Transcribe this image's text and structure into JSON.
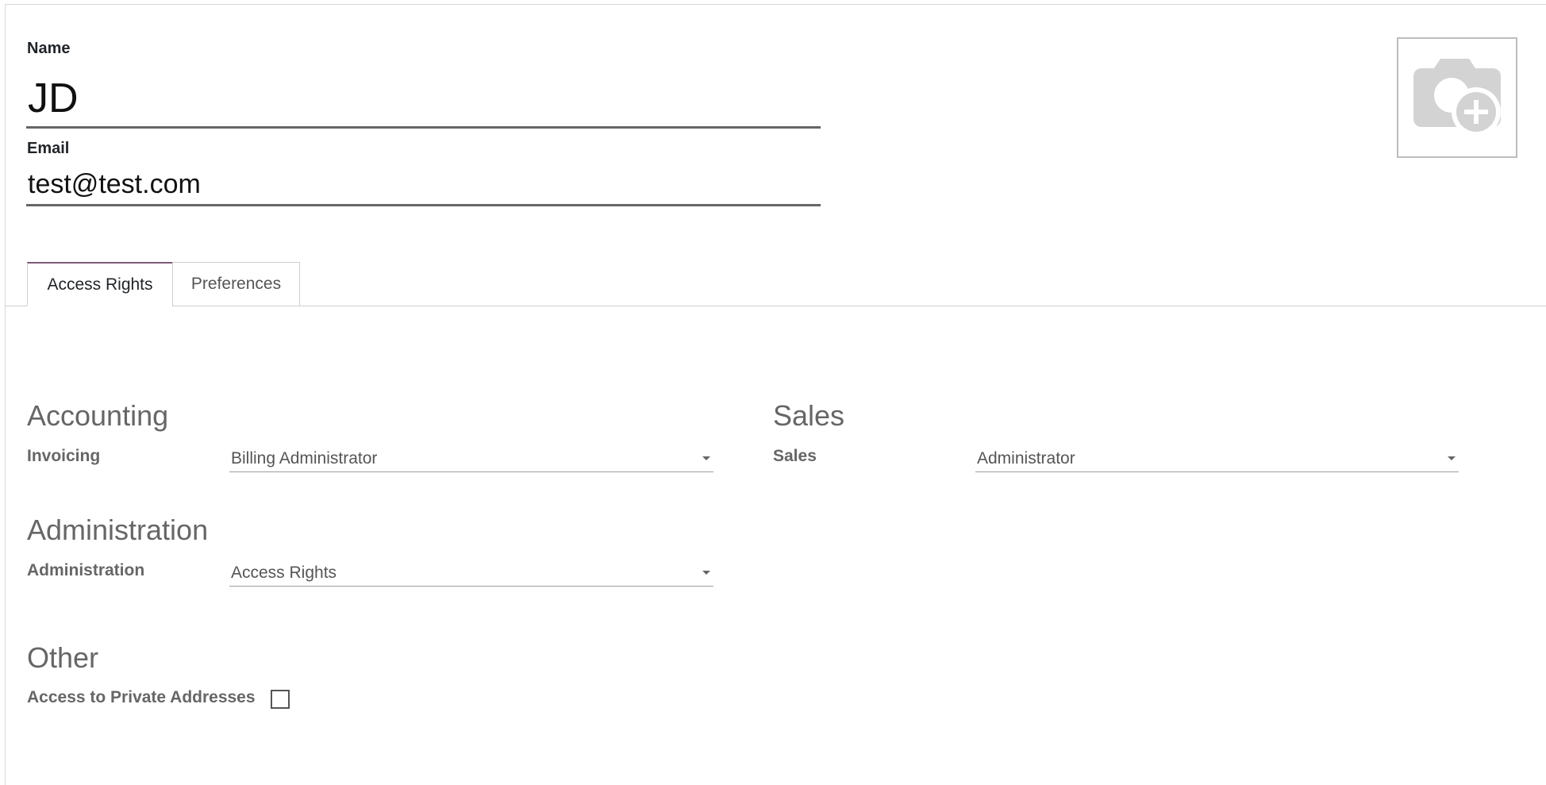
{
  "form": {
    "name_label": "Name",
    "name_value": "JD",
    "email_label": "Email",
    "email_value": "test@test.com",
    "avatar_icon": "camera-plus-icon"
  },
  "tabs": [
    {
      "label": "Access Rights",
      "active": true
    },
    {
      "label": "Preferences",
      "active": false
    }
  ],
  "groups": {
    "accounting": {
      "title": "Accounting",
      "field_label": "Invoicing",
      "value": "Billing Administrator"
    },
    "sales": {
      "title": "Sales",
      "field_label": "Sales",
      "value": "Administrator"
    },
    "administration": {
      "title": "Administration",
      "field_label": "Administration",
      "value": "Access Rights"
    },
    "other": {
      "title": "Other",
      "field_label": "Access to Private Addresses",
      "checked": false
    }
  },
  "colors": {
    "tab_accent": "#7c5b77",
    "section_text": "#666666"
  }
}
